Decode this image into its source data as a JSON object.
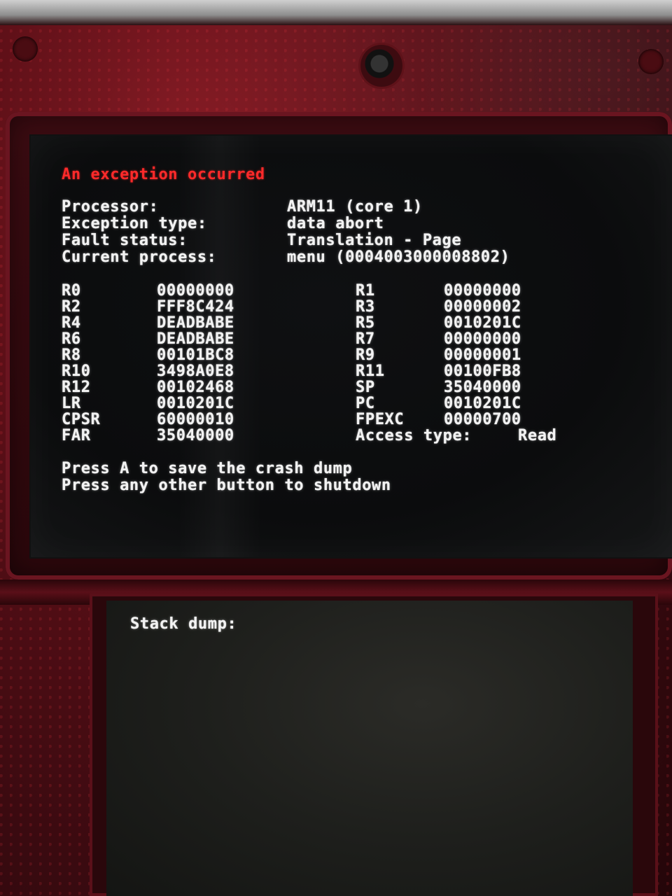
{
  "top_screen": {
    "title": "An exception occurred",
    "info": [
      {
        "label": "Processor:",
        "value": "ARM11 (core 1)"
      },
      {
        "label": "Exception type:",
        "value": "data abort"
      },
      {
        "label": "Fault status:",
        "value": "Translation - Page"
      },
      {
        "label": "Current process:",
        "value": "menu (0004003000008802)"
      }
    ],
    "registers": [
      {
        "r1": "R0",
        "v1": "00000000",
        "r2": "R1",
        "v2": "00000000"
      },
      {
        "r1": "R2",
        "v1": "FFF8C424",
        "r2": "R3",
        "v2": "00000002"
      },
      {
        "r1": "R4",
        "v1": "DEADBABE",
        "r2": "R5",
        "v2": "0010201C"
      },
      {
        "r1": "R6",
        "v1": "DEADBABE",
        "r2": "R7",
        "v2": "00000000"
      },
      {
        "r1": "R8",
        "v1": "00101BC8",
        "r2": "R9",
        "v2": "00000001"
      },
      {
        "r1": "R10",
        "v1": "3498A0E8",
        "r2": "R11",
        "v2": "00100FB8"
      },
      {
        "r1": "R12",
        "v1": "00102468",
        "r2": "SP",
        "v2": "35040000"
      },
      {
        "r1": "LR",
        "v1": "0010201C",
        "r2": "PC",
        "v2": "0010201C"
      },
      {
        "r1": "CPSR",
        "v1": "60000010",
        "r2": "FPEXC",
        "v2": "00000700"
      },
      {
        "r1": "FAR",
        "v1": "35040000",
        "r2": "Access type:",
        "v2": "Read"
      }
    ],
    "prompt_line1": "Press A to save the crash dump",
    "prompt_line2": "Press any other button to shutdown"
  },
  "bottom_screen": {
    "title": "Stack dump:"
  }
}
